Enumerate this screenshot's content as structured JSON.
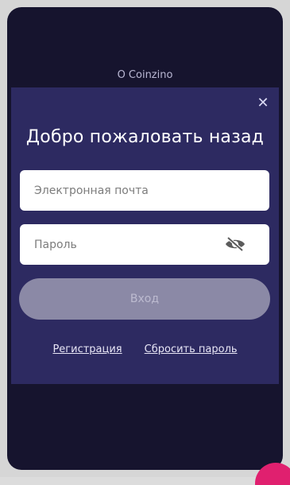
{
  "app": {
    "about_link": "О Coinzino"
  },
  "modal": {
    "title": "Добро пожаловать назад",
    "email_placeholder": "Электронная почта",
    "password_placeholder": "Пароль",
    "login_button": "Вход",
    "links": {
      "register": "Регистрация",
      "reset_password": "Сбросить пароль"
    }
  },
  "icons": {
    "close": "close-icon",
    "password_visibility": "eye-slash-icon"
  },
  "colors": {
    "background": "#16142e",
    "modal": "#2d2a61",
    "button_disabled": "#8b89a6",
    "accent": "#e0206f"
  }
}
